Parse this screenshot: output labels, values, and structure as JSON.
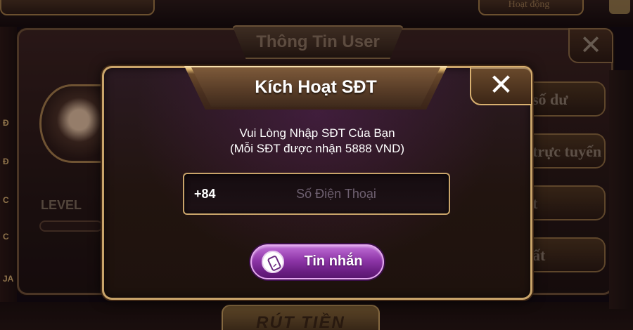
{
  "background": {
    "top_tab": "Hoạt động",
    "side_letters": [
      "Đ",
      "Đ",
      "C",
      "C",
      "JA"
    ],
    "bottom_button": "RÚT TIỀN"
  },
  "user_panel": {
    "title": "Thông Tin User",
    "close_symbol": "✕",
    "level_label": "LEVEL",
    "side_buttons": [
      "số dư",
      "trực tuyến",
      "t",
      "ất"
    ]
  },
  "modal": {
    "title": "Kích Hoạt SĐT",
    "close_symbol": "✕",
    "instruction_line1": "Vui Lòng Nhập SĐT Của Bạn",
    "instruction_line2": "(Mỗi SĐT được nhận 5888 VND)",
    "phone_prefix": "+84",
    "phone_placeholder": "Số Điện Thoại",
    "phone_value": "",
    "sms_button_label": "Tin nhắn",
    "sms_button_icon": "phone-icon"
  },
  "colors": {
    "gold_border": "#c9a46a",
    "button_purple": "#8e36a8",
    "panel_brown": "#251614"
  }
}
